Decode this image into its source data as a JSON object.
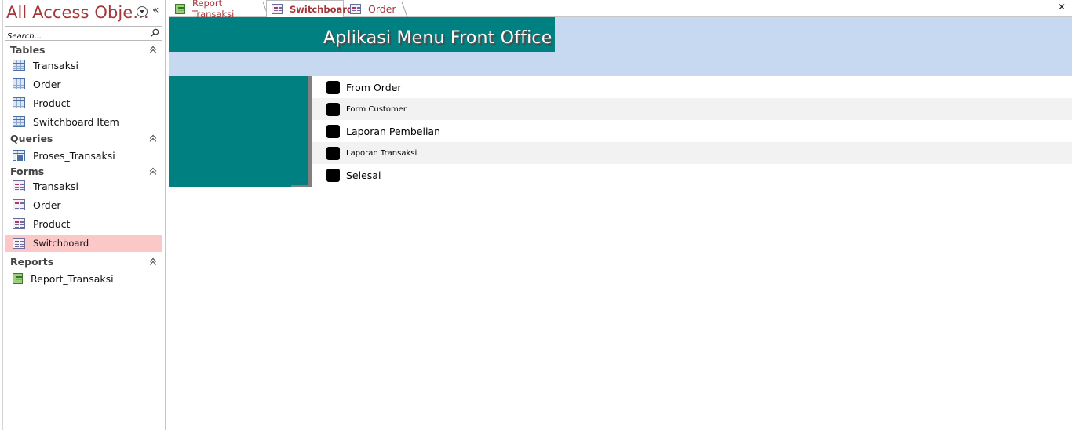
{
  "nav": {
    "title": "All Access Obje...",
    "search_placeholder": "Search...",
    "groups": [
      {
        "title": "Tables",
        "items": [
          {
            "label": "Transaksi",
            "icon": "table-icon"
          },
          {
            "label": "Order",
            "icon": "table-icon"
          },
          {
            "label": "Product",
            "icon": "table-icon"
          },
          {
            "label": "Switchboard Item",
            "icon": "table-icon"
          }
        ]
      },
      {
        "title": "Queries",
        "items": [
          {
            "label": "Proses_Transaksi",
            "icon": "query-icon"
          }
        ]
      },
      {
        "title": "Forms",
        "items": [
          {
            "label": "Transaksi",
            "icon": "form-icon"
          },
          {
            "label": "Order",
            "icon": "form-icon"
          },
          {
            "label": "Product",
            "icon": "form-icon"
          },
          {
            "label": "Switchboard",
            "icon": "form-icon",
            "active": true
          }
        ]
      },
      {
        "title": "Reports",
        "items": [
          {
            "label": "Report_Transaksi",
            "icon": "report-icon"
          }
        ]
      }
    ]
  },
  "tabs": [
    {
      "label": "Report Transaksi",
      "icon": "report-icon",
      "active": false
    },
    {
      "label": "Switchboard",
      "icon": "form-icon",
      "active": true
    },
    {
      "label": "Order",
      "icon": "form-icon",
      "active": false
    }
  ],
  "form": {
    "title": "Aplikasi Menu Front Office",
    "menu_items": [
      "From Order",
      "Form Customer",
      "Laporan Pembelian",
      "Laporan Transaksi",
      "Selesai"
    ]
  },
  "colors": {
    "teal": "#008080",
    "header_band": "#c6d9f0",
    "accent_red": "#a4373a",
    "active_item": "#fbc7c7"
  }
}
